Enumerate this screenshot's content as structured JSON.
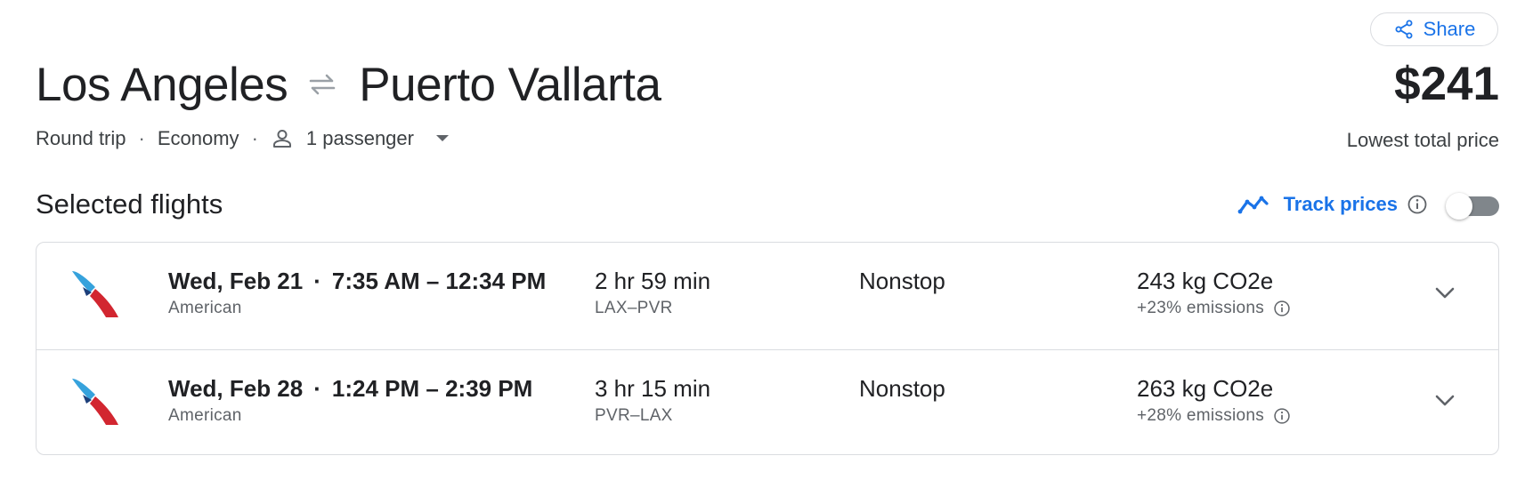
{
  "share": {
    "label": "Share",
    "icon": "share-icon"
  },
  "route": {
    "origin": "Los Angeles",
    "destination": "Puerto Vallarta",
    "swap_icon": "swap-arrows-icon"
  },
  "trip": {
    "type": "Round trip",
    "class": "Economy",
    "separator": "·",
    "passengers": "1 passenger"
  },
  "price": {
    "amount": "$241",
    "label": "Lowest total price"
  },
  "section": {
    "title": "Selected flights"
  },
  "track_prices": {
    "label": "Track prices",
    "enabled": false
  },
  "flights": [
    {
      "date": "Wed, Feb 21",
      "dot": "·",
      "times": "7:35 AM – 12:34 PM",
      "airline": "American",
      "duration": "2 hr 59 min",
      "route": "LAX–PVR",
      "stops": "Nonstop",
      "emissions": "243 kg CO2e",
      "emissions_delta": "+23% emissions"
    },
    {
      "date": "Wed, Feb 28",
      "dot": "·",
      "times": "1:24 PM – 2:39 PM",
      "airline": "American",
      "duration": "3 hr 15 min",
      "route": "PVR–LAX",
      "stops": "Nonstop",
      "emissions": "263 kg CO2e",
      "emissions_delta": "+28% emissions"
    }
  ],
  "colors": {
    "accent": "#1a73e8",
    "text": "#202124",
    "secondary_text": "#5f6368",
    "border": "#dadce0",
    "toggle_off": "#80868b"
  }
}
